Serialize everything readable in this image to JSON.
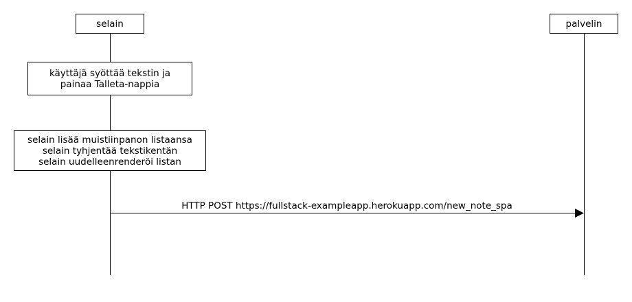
{
  "participants": {
    "browser": {
      "label": "selain"
    },
    "server": {
      "label": "palvelin"
    }
  },
  "notes": [
    {
      "lines": [
        "käyttäjä syöttää tekstin ja",
        "painaa Talleta-nappia"
      ]
    },
    {
      "lines": [
        "selain lisää muistiinpanon listaansa",
        "selain tyhjentää tekstikentän",
        "selain uudelleenrenderöi listan"
      ]
    }
  ],
  "messages": [
    {
      "from": "selain",
      "to": "palvelin",
      "label": "HTTP POST https://fullstack-exampleapp.herokuapp.com/new_note_spa"
    }
  ]
}
